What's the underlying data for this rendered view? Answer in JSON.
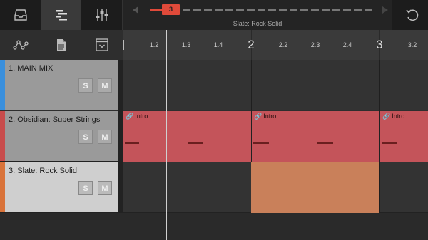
{
  "toolbar": {
    "buttons": [
      {
        "icon": "inbox-icon",
        "active": false
      },
      {
        "icon": "arrange-icon",
        "active": true
      },
      {
        "icon": "mixer-sliders-icon",
        "active": false
      }
    ],
    "undo_icon": "undo-icon"
  },
  "transport": {
    "bar_marker": "3",
    "current_track": "Slate: Rock Solid",
    "colors": {
      "accent": "#e04a3a"
    }
  },
  "tools": [
    {
      "icon": "automation-nodes-icon"
    },
    {
      "icon": "document-icon"
    },
    {
      "icon": "dropdown-window-icon"
    }
  ],
  "ruler": {
    "labels": [
      "1.2",
      "1.3",
      "1.4",
      "2",
      "2.2",
      "2.3",
      "2.4",
      "3",
      "3.2"
    ]
  },
  "tracks": [
    {
      "name": "1. MAIN MIX",
      "solo": "S",
      "mute": "M",
      "color": "#3a8fdc"
    },
    {
      "name": "2. Obsidian: Super Strings",
      "solo": "S",
      "mute": "M",
      "color": "#c84c4c"
    },
    {
      "name": "3. Slate: Rock Solid",
      "solo": "S",
      "mute": "M",
      "color": "#d9733a"
    }
  ],
  "clips": {
    "strings_label": "Intro",
    "colors": {
      "strings": "#c4545a",
      "drums": "#c9805a"
    }
  }
}
